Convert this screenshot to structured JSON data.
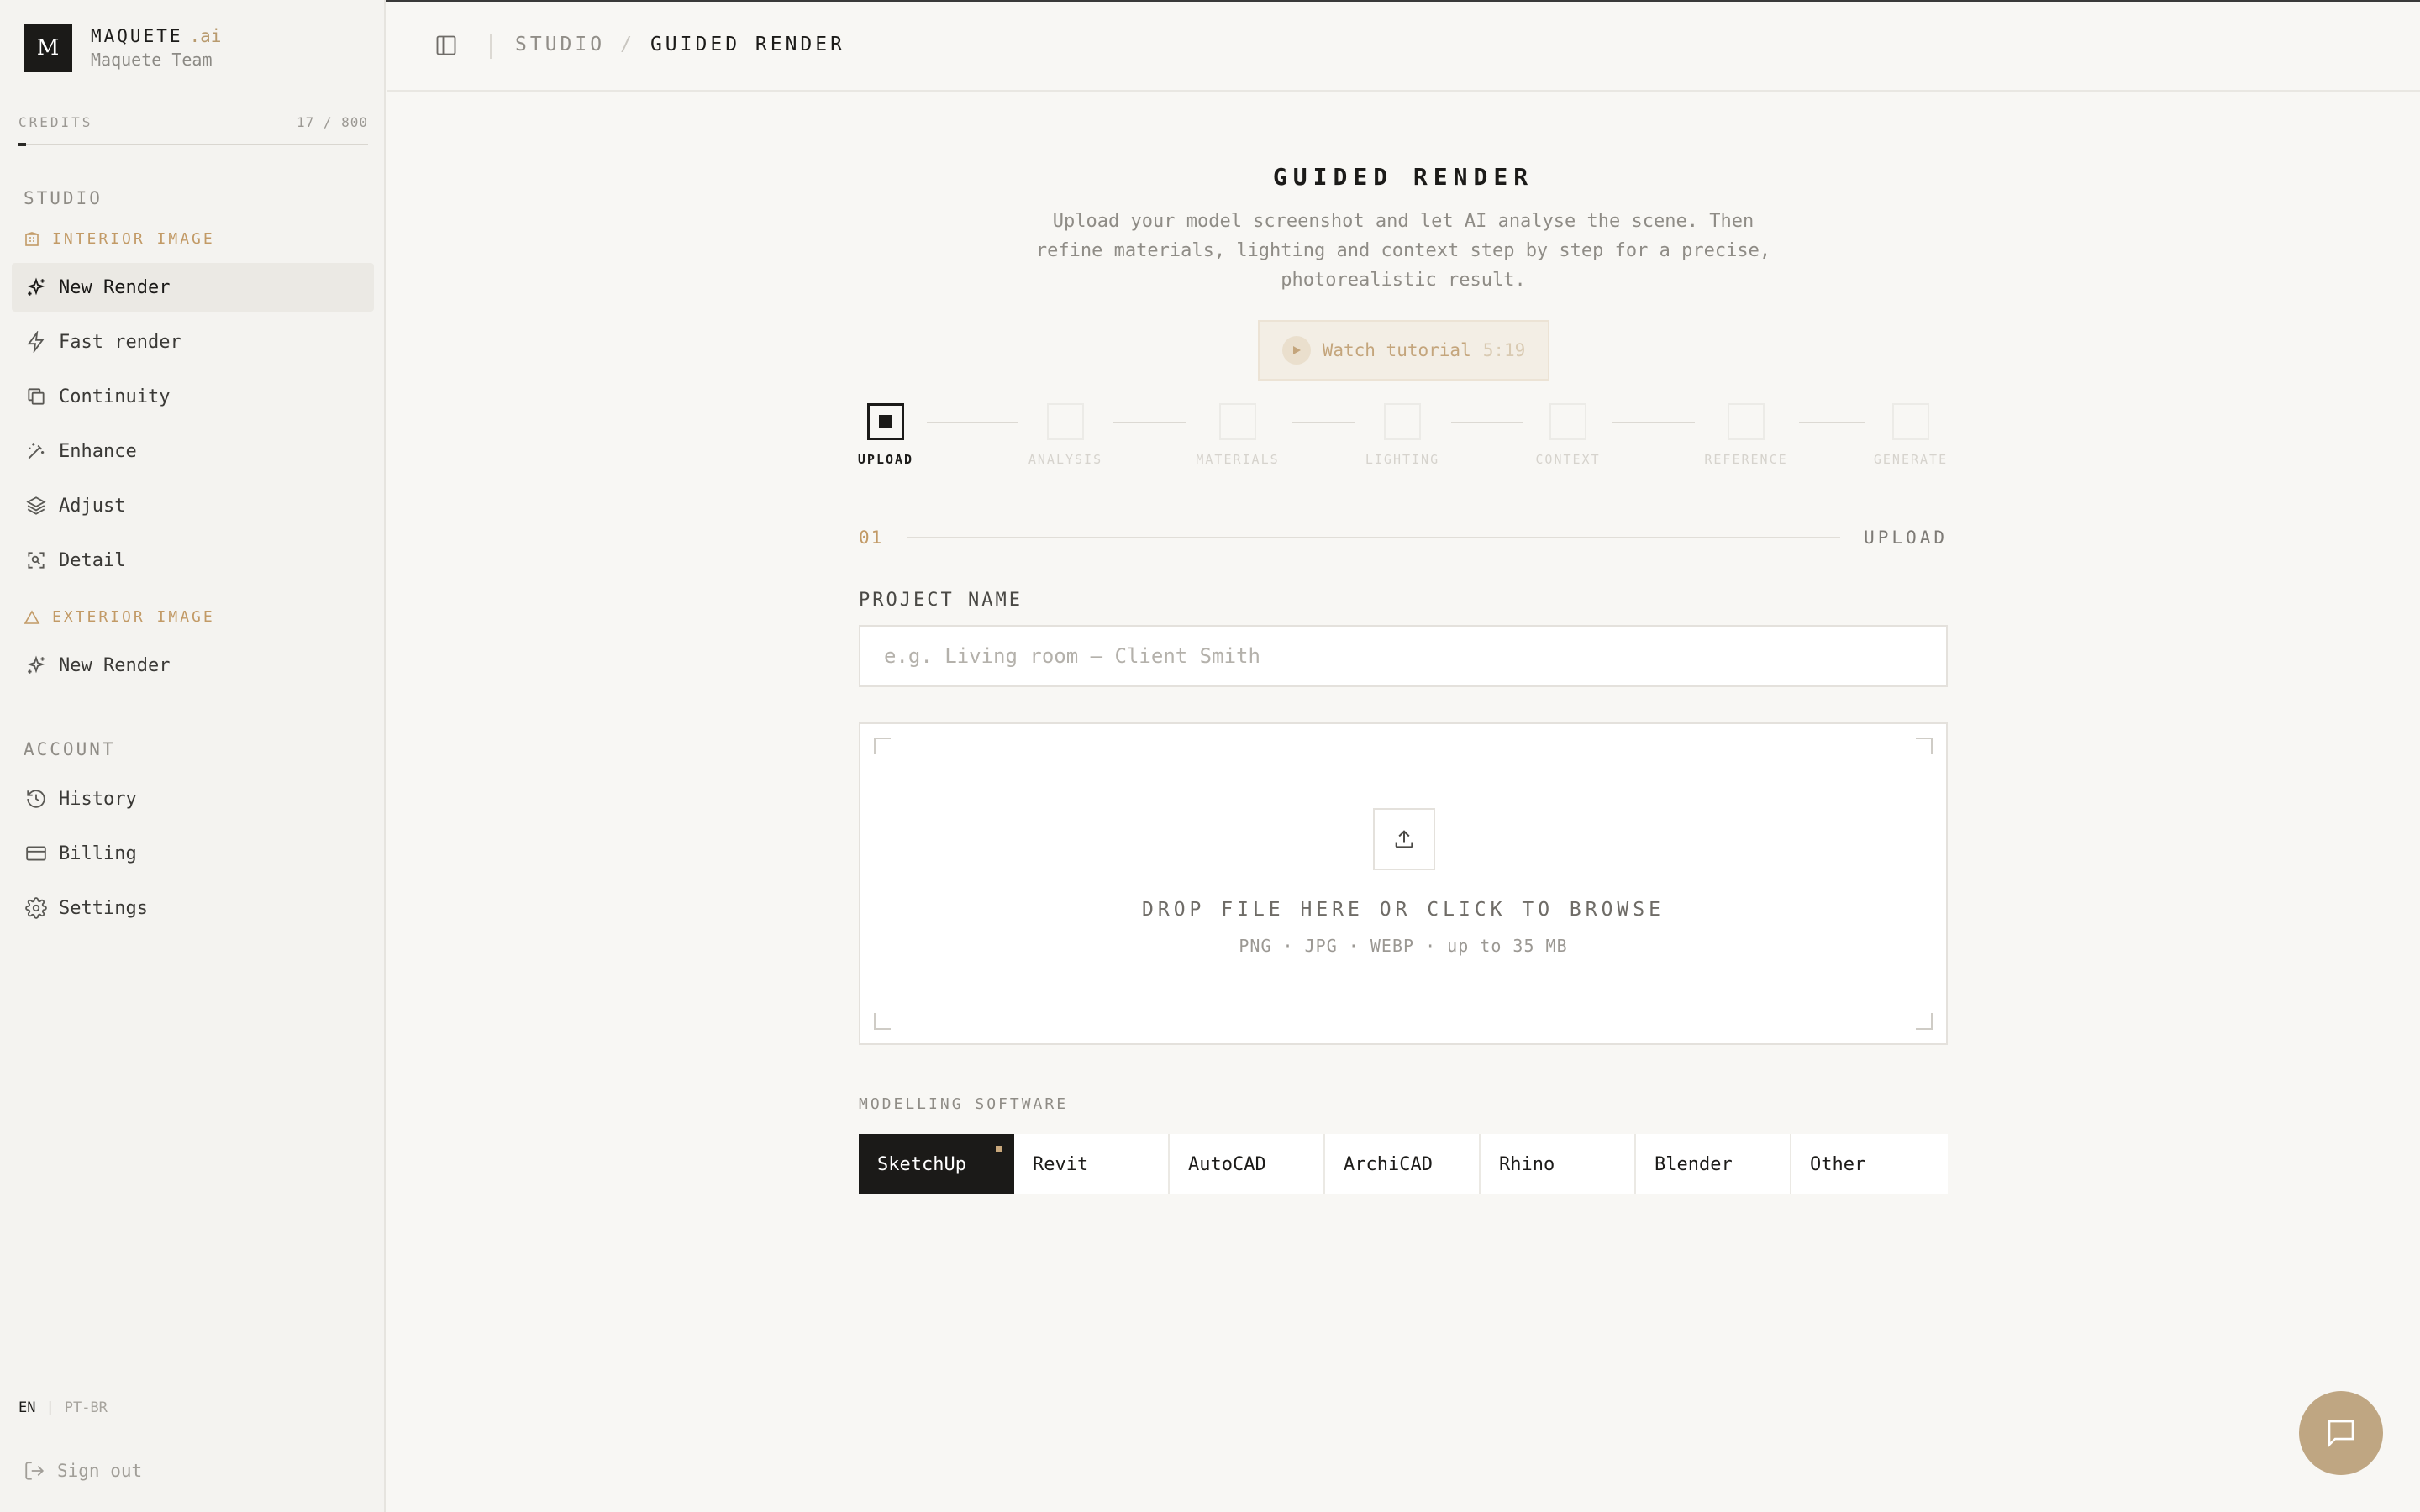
{
  "brand": {
    "logo_letter": "M",
    "name": "MAQUETE",
    "suffix": ".ai",
    "team": "Maquete Team"
  },
  "credits": {
    "label": "CREDITS",
    "count": "17 / 800",
    "used_fraction": 0.02125
  },
  "sidebar": {
    "studio_title": "STUDIO",
    "interior_title": "INTERIOR IMAGE",
    "interior_items": [
      {
        "label": "New Render",
        "icon": "sparkles-icon",
        "active": true
      },
      {
        "label": "Fast render",
        "icon": "lightning-icon"
      },
      {
        "label": "Continuity",
        "icon": "copy-icon"
      },
      {
        "label": "Enhance",
        "icon": "magic-wand-icon"
      },
      {
        "label": "Adjust",
        "icon": "layers-icon"
      },
      {
        "label": "Detail",
        "icon": "scan-icon"
      }
    ],
    "exterior_title": "EXTERIOR IMAGE",
    "exterior_items": [
      {
        "label": "New Render",
        "icon": "sparkles-icon"
      }
    ],
    "account_title": "ACCOUNT",
    "account_items": [
      {
        "label": "History",
        "icon": "history-icon"
      },
      {
        "label": "Billing",
        "icon": "credit-card-icon"
      },
      {
        "label": "Settings",
        "icon": "gear-icon"
      }
    ],
    "lang_en": "EN",
    "lang_sep": "|",
    "lang_pt": "PT-BR",
    "sign_out": "Sign out"
  },
  "header": {
    "crumb_studio": "STUDIO",
    "crumb_sep": "/",
    "crumb_current": "GUIDED RENDER"
  },
  "main": {
    "title": "GUIDED RENDER",
    "description": "Upload your model screenshot and let AI analyse the scene. Then refine materials, lighting and context step by step for a precise, photorealistic result.",
    "tutorial_label": "Watch tutorial",
    "tutorial_time": "5:19",
    "steps": [
      "UPLOAD",
      "ANALYSIS",
      "MATERIALS",
      "LIGHTING",
      "CONTEXT",
      "REFERENCE",
      "GENERATE"
    ],
    "section_number": "01",
    "section_name": "UPLOAD",
    "project_label": "PROJECT NAME",
    "project_placeholder": "e.g. Living room — Client Smith",
    "project_value": "",
    "drop_title": "DROP FILE HERE OR CLICK TO BROWSE",
    "drop_sub": "PNG · JPG · WEBP · up to 35 MB",
    "software_label": "MODELLING SOFTWARE",
    "software_options": [
      "SketchUp",
      "Revit",
      "AutoCAD",
      "ArchiCAD",
      "Rhino",
      "Blender",
      "Other"
    ],
    "software_selected": "SketchUp"
  },
  "colors": {
    "accent": "#c29a66",
    "dark": "#1b1a18",
    "chat_button": "#bfa682",
    "background": "#f8f7f4"
  }
}
